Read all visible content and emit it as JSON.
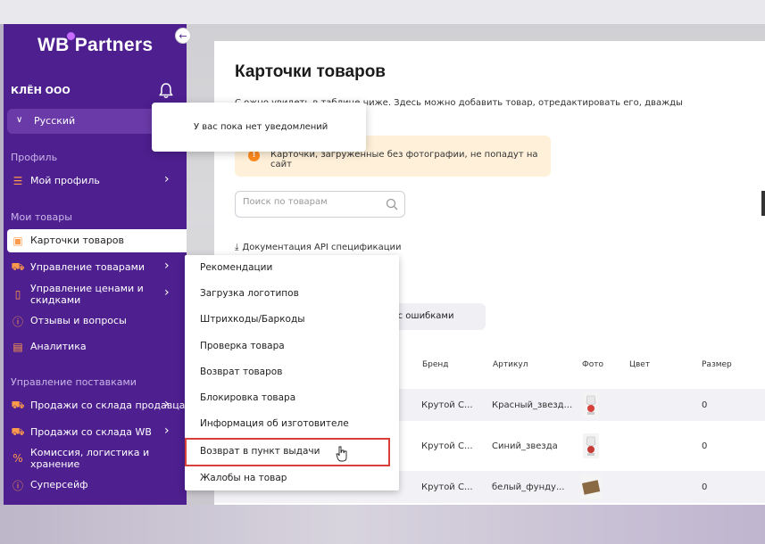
{
  "app": {
    "logo": "WB Partners",
    "org_name": "КЛЁН ООО",
    "language": "Русский"
  },
  "notification": {
    "text": "У вас пока нет уведомлений"
  },
  "sidebar": {
    "sections": [
      {
        "label": "Профиль"
      },
      {
        "label": "Мои товары"
      },
      {
        "label": "Управление поставками"
      }
    ],
    "items": [
      {
        "label": "Мой профиль",
        "icon": "sliders-icon"
      },
      {
        "label": "Карточки товаров",
        "icon": "box-icon"
      },
      {
        "label": "Управление товарами",
        "icon": "truck-icon"
      },
      {
        "label": "Управление ценами и скидками",
        "icon": "tag-icon"
      },
      {
        "label": "Отзывы и вопросы",
        "icon": "question-icon"
      },
      {
        "label": "Аналитика",
        "icon": "chart-icon"
      },
      {
        "label": "Продажи со склада продавца",
        "icon": "cart-icon"
      },
      {
        "label": "Продажи со склада WB",
        "icon": "truck-icon"
      },
      {
        "label": "Комиссия, логистика и хранение",
        "icon": "percent-icon"
      },
      {
        "label": "Суперсейф",
        "icon": "info-icon"
      }
    ]
  },
  "main": {
    "title": "Карточки товаров",
    "subtitle": "С                    ожно увидеть в таблице ниже. Здесь можно добавить товар, отредактировать его, дважды",
    "warning": "Карточки, загруженные без фотографии, не попадут на сайт",
    "search_placeholder": "Поиск по товарам",
    "api_link": "Документация API спецификации",
    "tab_errors": "чки с ошибками",
    "table": {
      "headers": [
        "Бренд",
        "Артикул",
        "Фото",
        "Цвет",
        "Размер"
      ],
      "rows": [
        {
          "brand": "Крутой С...",
          "article": "Красный_звезд...",
          "size": "0"
        },
        {
          "brand": "Крутой С...",
          "article": "Синий_звезда",
          "size": "0"
        },
        {
          "brand": "Крутой С...",
          "article": "белый_фунду...",
          "size": "0"
        }
      ]
    }
  },
  "dropdown": {
    "items": [
      "Рекомендации",
      "Загрузка логотипов",
      "Штрихкоды/Баркоды",
      "Проверка товара",
      "Возврат товаров",
      "Блокировка товара",
      "Информация об изготовителе",
      "Возврат в пункт выдачи",
      "Жалобы на товар"
    ],
    "highlighted_index": 7
  },
  "colors": {
    "sidebar_bg": "#4d1f8f",
    "accent_orange": "#ff8a1f",
    "highlight_red": "#d8403a",
    "warning_bg": "#fff1d9"
  }
}
